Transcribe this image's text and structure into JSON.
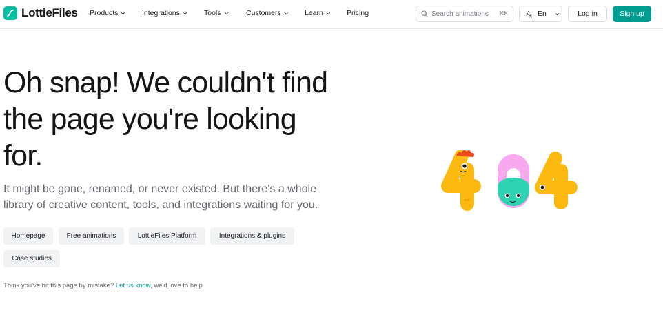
{
  "brand": {
    "name": "LottieFiles",
    "accent": "#00c1a2"
  },
  "nav": {
    "items": [
      {
        "label": "Products",
        "has_menu": true
      },
      {
        "label": "Integrations",
        "has_menu": true
      },
      {
        "label": "Tools",
        "has_menu": true
      },
      {
        "label": "Customers",
        "has_menu": true
      },
      {
        "label": "Learn",
        "has_menu": true
      },
      {
        "label": "Pricing",
        "has_menu": false
      }
    ],
    "search_placeholder": "Search animations",
    "search_shortcut": "⌘K",
    "language": "En",
    "login": "Log in",
    "signup": "Sign up",
    "signup_color": "#019d91"
  },
  "hero": {
    "headline_lines": [
      "Oh snap! We couldn't find",
      "the page you're looking",
      "for."
    ],
    "subtitle_lines": [
      "It might be gone, renamed, or never existed. But there's a whole",
      "library of creative content, tools, and integrations waiting for you."
    ],
    "links": [
      "Homepage",
      "Free animations",
      "LottieFiles Platform",
      "Integrations & plugins",
      "Case studies"
    ],
    "footnote_before": "Think you've hit this page by mistake? ",
    "footnote_link": "Let us know",
    "footnote_after": ", we'd love to help."
  },
  "illustration": {
    "text": "404",
    "colors": {
      "four": "#fdb90f",
      "zero_top": "#f7a8ee",
      "zero_bottom": "#2ed3b2",
      "crest": "#ee4a1f"
    }
  }
}
